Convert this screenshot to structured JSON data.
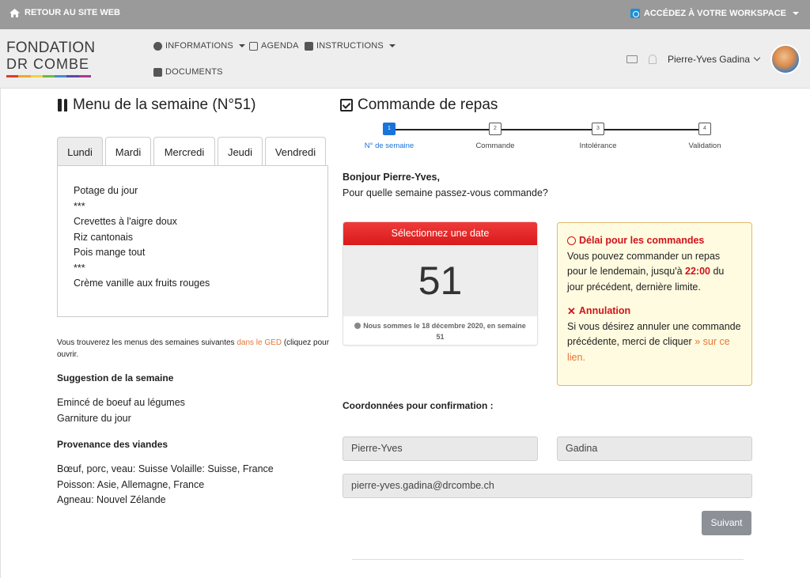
{
  "topbar": {
    "back_label": "RETOUR AU SITE WEB",
    "workspace_label": "ACCÉDEZ À VOTRE WORKSPACE"
  },
  "logo": {
    "line1": "FONDATION",
    "line2": "DR COMBE",
    "stripe_colors": [
      "#e23a2c",
      "#f0a72a",
      "#f1d33a",
      "#6cb84a",
      "#3f8fd0",
      "#5b4aa8",
      "#a63c8e"
    ]
  },
  "nav": {
    "informations": "INFORMATIONS",
    "agenda": "AGENDA",
    "instructions": "INSTRUCTIONS",
    "documents": "DOCUMENTS",
    "user_name": "Pierre-Yves Gadina"
  },
  "menu": {
    "title": "Menu de la semaine (N°51)",
    "tabs": [
      "Lundi",
      "Mardi",
      "Mercredi",
      "Jeudi",
      "Vendredi"
    ],
    "active_tab": "Lundi",
    "items": [
      "Potage du jour",
      "***",
      "Crevettes à l'aigre doux",
      "Riz cantonais",
      "Pois mange tout",
      "***",
      "Crème vanille aux fruits rouges"
    ],
    "note_before": "Vous trouverez les menus des semaines suivantes ",
    "note_link": "dans le GED",
    "note_after": " (cliquez pour ouvrir."
  },
  "suggestion": {
    "title": "Suggestion de la semaine",
    "lines": [
      "Emincé de boeuf au légumes",
      "Garniture du jour"
    ]
  },
  "provenance": {
    "title": "Provenance des viandes",
    "lines": [
      "Bœuf, porc, veau: Suisse Volaille: Suisse, France",
      "Poisson: Asie, Allemagne, France",
      "Agneau: Nouvel Zélande"
    ]
  },
  "order": {
    "title": "Commande de repas",
    "steps": [
      {
        "num": "1",
        "label": "N° de semaine"
      },
      {
        "num": "2",
        "label": "Commande"
      },
      {
        "num": "3",
        "label": "Intolérance"
      },
      {
        "num": "4",
        "label": "Validation"
      }
    ],
    "greeting": "Bonjour Pierre-Yves,",
    "question": "Pour quelle semaine passez-vous commande?",
    "date_header": "Sélectionnez une date",
    "week_number": "51",
    "date_note": "Nous sommes le 18 décembre 2020, en semaine 51"
  },
  "alert": {
    "deadline_title": "Délai pour les commandes",
    "deadline_text1": "Vous pouvez commander un repas pour le lendemain, jusqu'à ",
    "deadline_time": "22:00",
    "deadline_text2": " du jour précédent, dernière limite.",
    "cancel_title": "Annulation",
    "cancel_text": "Si vous désirez annuler une commande précédente, merci de cliquer ",
    "cancel_link": "» sur ce lien."
  },
  "confirmation": {
    "title": "Coordonnées pour confirmation :",
    "first_name": "Pierre-Yves",
    "last_name": "Gadina",
    "email": "pierre-yves.gadina@drcombe.ch",
    "next_button": "Suivant"
  }
}
